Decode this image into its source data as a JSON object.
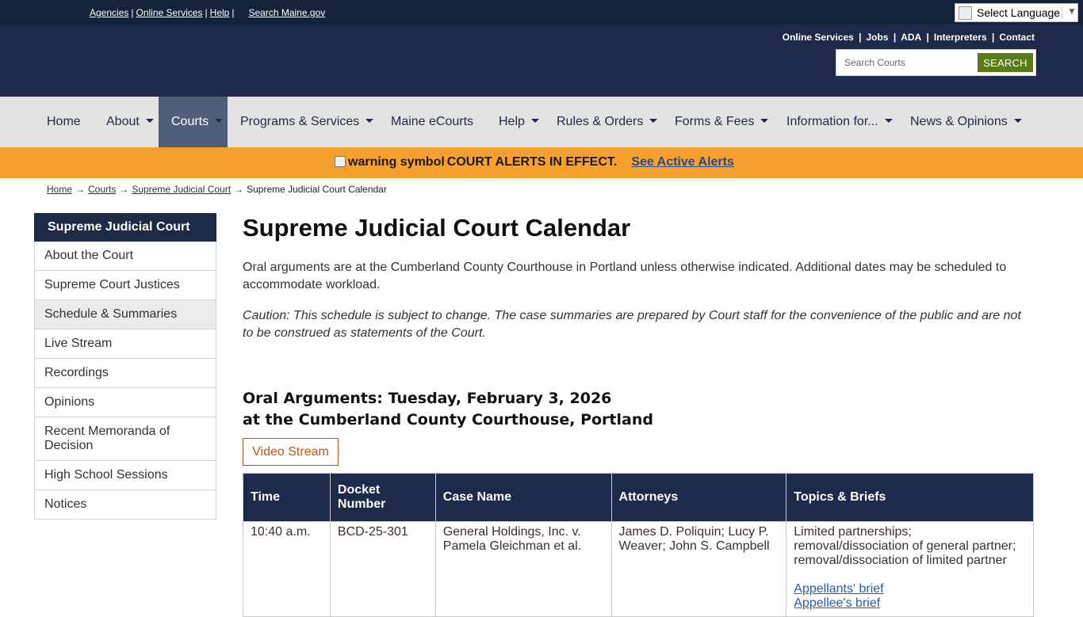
{
  "topbar": {
    "links": [
      "Agencies",
      "Online Services",
      "Help"
    ],
    "search_maine": "Search Maine.gov",
    "language_label": "Select Language",
    "language_arrow": "▼"
  },
  "header": {
    "links": [
      "Online Services",
      "Jobs",
      "ADA",
      "Interpreters",
      "Contact"
    ],
    "search_placeholder": "Search Courts",
    "search_button": "SEARCH"
  },
  "nav": {
    "items": [
      {
        "label": "Home",
        "has_caret": false
      },
      {
        "label": "About",
        "has_caret": true
      },
      {
        "label": "Courts",
        "has_caret": true,
        "active": true
      },
      {
        "label": "Programs & Services",
        "has_caret": true
      },
      {
        "label": "Maine eCourts",
        "has_caret": false
      },
      {
        "label": "Help",
        "has_caret": true
      },
      {
        "label": "Rules & Orders",
        "has_caret": true
      },
      {
        "label": "Forms & Fees",
        "has_caret": true
      },
      {
        "label": "Information for...",
        "has_caret": true
      },
      {
        "label": "News & Opinions",
        "has_caret": true
      }
    ]
  },
  "alert": {
    "img_alt": "warning symbol",
    "message": "COURT ALERTS IN EFFECT.",
    "link": "See Active Alerts"
  },
  "breadcrumb": {
    "items": [
      "Home",
      "Courts",
      "Supreme Judicial Court"
    ],
    "current": "Supreme Judicial Court Calendar",
    "separator": "→"
  },
  "sidebar": {
    "heading": "Supreme Judicial Court",
    "items": [
      "About the Court",
      "Supreme Court Justices",
      "Schedule & Summaries",
      "Live Stream",
      "Recordings",
      "Opinions",
      "Recent Memoranda of Decision",
      "High School Sessions",
      "Notices"
    ],
    "selected": "Schedule & Summaries"
  },
  "main": {
    "title": "Supreme Judicial Court Calendar",
    "intro": "Oral arguments are at the Cumberland County Courthouse in Portland unless otherwise indicated. Additional dates may be scheduled to accommodate workload.",
    "caution": "Caution: This schedule is subject to change. The case summaries are prepared by Court staff for the convenience of the public and are not to be construed as statements of the Court.",
    "session_line1": "Oral Arguments: Tuesday, February 3, 2026",
    "session_line2": "at the Cumberland County Courthouse, Portland",
    "video_button": "Video Stream",
    "table": {
      "headers": [
        "Time",
        "Docket Number",
        "Case Name",
        "Attorneys",
        "Topics & Briefs"
      ],
      "rows": [
        {
          "time": "10:40 a.m.",
          "docket": "BCD-25-301",
          "case_name": "General Holdings, Inc. v. Pamela Gleichman et al.",
          "attorneys": "James D. Poliquin; Lucy P. Weaver; John S. Campbell",
          "topics": "Limited partnerships; removal/dissociation of general partner; removal/dissociation of limited partner",
          "briefs": [
            "Appellants' brief",
            "Appellee's brief"
          ]
        }
      ]
    }
  }
}
